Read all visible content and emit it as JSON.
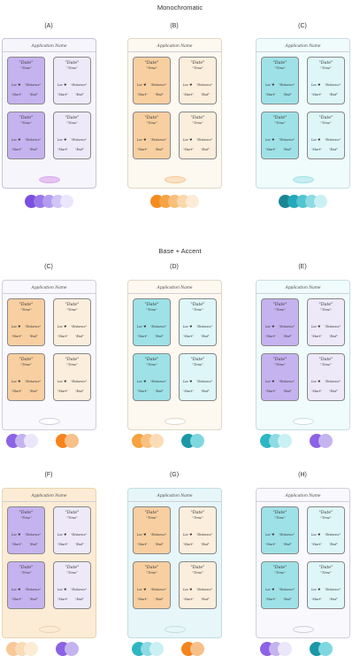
{
  "headings": {
    "monochromatic": "Monochromatic",
    "base_accent": "Base + Accent"
  },
  "card_text": {
    "date": "Date",
    "time": "Time",
    "location": "Loc",
    "distance": "Distance",
    "start": "Start",
    "end": "End"
  },
  "phones": [
    {
      "label": "(A)",
      "app_name": "Application Name",
      "bg": "#f7f5fc",
      "border": "#c5c2d6",
      "cards": [
        "#c5b3ef",
        "#ede9f8",
        "#c5b3ef",
        "#ede9f8"
      ],
      "pill": "#e5c4f2",
      "pill_border": "#d8a9ec",
      "swatches": [
        [
          "#7a4fe0",
          "#9a78ea",
          "#b49cf0",
          "#d1c4f6",
          "#ebe6fb"
        ]
      ]
    },
    {
      "label": "(B)",
      "app_name": "Application Name",
      "bg": "#fdf8f0",
      "border": "#e0d8c8",
      "cards": [
        "#f8cfa1",
        "#fbeedd",
        "#f8cfa1",
        "#fbeedd"
      ],
      "pill": "#fbe1c5",
      "pill_border": "#f5c892",
      "swatches": [
        [
          "#f28c1e",
          "#f6a346",
          "#f8bf7a",
          "#fad8ad",
          "#fcebd6"
        ]
      ]
    },
    {
      "label": "(C)",
      "app_name": "Application Name",
      "bg": "#f0fbfc",
      "border": "#c8dde0",
      "cards": [
        "#9ee2e7",
        "#def6f8",
        "#9ee2e7",
        "#def6f8"
      ],
      "pill": "#c8eef2",
      "pill_border": "#9ee0e6",
      "swatches": [
        [
          "#1b8595",
          "#25a8b8",
          "#52c5d1",
          "#8edbe3",
          "#cbf0f3"
        ]
      ]
    },
    {
      "label": "(C)",
      "app_name": "Application Name",
      "bg": "#f8f8fd",
      "border": "#cfcfdb",
      "cards": [
        "#f8cfa1",
        "#fbeedd",
        "#f8cfa1",
        "#fbeedd"
      ],
      "pill": "#ffffff",
      "pill_border": "#cfcfdb",
      "swatches": [
        [
          "#8c62e6",
          "#c5b3ef",
          "#ebe6fb"
        ],
        [
          "#f6831c",
          "#f8c08a"
        ]
      ]
    },
    {
      "label": "(D)",
      "app_name": "Application Name",
      "bg": "#fdf8f0",
      "border": "#e0d8c8",
      "cards": [
        "#9ee2e7",
        "#def6f8",
        "#9ee2e7",
        "#def6f8"
      ],
      "pill": "#ffffff",
      "pill_border": "#e0d8c8",
      "swatches": [
        [
          "#f7a13f",
          "#f9c080",
          "#fcdcb6"
        ],
        [
          "#1b97a6",
          "#7fd8e0"
        ]
      ]
    },
    {
      "label": "(E)",
      "app_name": "Application Name",
      "bg": "#f0fbfc",
      "border": "#c8dde0",
      "cards": [
        "#c5b3ef",
        "#ede9f8",
        "#c5b3ef",
        "#ede9f8"
      ],
      "pill": "#ffffff",
      "pill_border": "#c8dde0",
      "swatches": [
        [
          "#2fb6c4",
          "#8edbe3",
          "#cbf0f3"
        ],
        [
          "#8c62e6",
          "#c5b3ef"
        ]
      ]
    },
    {
      "label": "(F)",
      "app_name": "Application Name",
      "bg": "#fcecd5",
      "border": "#e8d4b3",
      "cards": [
        "#c5b3ef",
        "#ede9f8",
        "#c5b3ef",
        "#ede9f8"
      ],
      "pill": "#fcecd5",
      "pill_border": "#e8d4b3",
      "swatches": [
        [
          "#f8c896",
          "#fadcb8",
          "#fcecd5"
        ],
        [
          "#8c62e6",
          "#c5b3ef"
        ]
      ]
    },
    {
      "label": "(G)",
      "app_name": "Application Name",
      "bg": "#e6f6f9",
      "border": "#c4dde2",
      "cards": [
        "#f8cfa1",
        "#fbeedd",
        "#f8cfa1",
        "#fbeedd"
      ],
      "pill": "#e6f6f9",
      "pill_border": "#c4dde2",
      "swatches": [
        [
          "#2fb6c4",
          "#8edbe3",
          "#cbf0f3"
        ],
        [
          "#f6831c",
          "#f8c08a"
        ]
      ]
    },
    {
      "label": "(H)",
      "app_name": "Application Name",
      "bg": "#f8f8fd",
      "border": "#cfcfdb",
      "cards": [
        "#9ee2e7",
        "#def6f8",
        "#9ee2e7",
        "#def6f8"
      ],
      "pill": "#f8f8fd",
      "pill_border": "#cfcfdb",
      "swatches": [
        [
          "#8c62e6",
          "#c5b3ef",
          "#ebe6fb"
        ],
        [
          "#1b97a6",
          "#7fd8e0"
        ]
      ]
    }
  ]
}
